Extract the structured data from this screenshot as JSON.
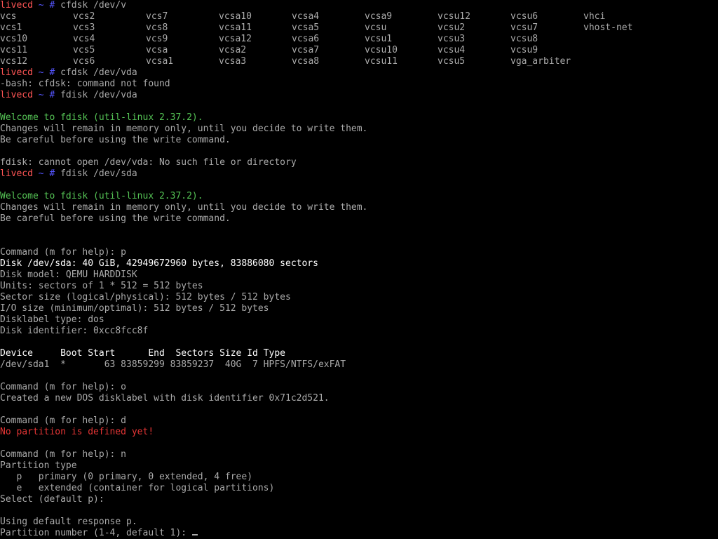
{
  "colors": {
    "background": "#000000",
    "default_text": "#aaaaaa",
    "bright_text": "#ffffff",
    "prompt_user": "#ff5555",
    "prompt_path": "#5555ff",
    "welcome_green": "#55c455",
    "error_red": "#e53535"
  },
  "prompt": {
    "user": "livecd",
    "path": "~",
    "symbol": "#"
  },
  "session": [
    {
      "kind": "prompt",
      "command": "cfdsk /dev/v"
    },
    {
      "kind": "ls_row",
      "cells": [
        "vcs",
        "vcs2",
        "vcs7",
        "vcsa10",
        "vcsa4",
        "vcsa9",
        "vcsu12",
        "vcsu6",
        "vhci"
      ]
    },
    {
      "kind": "ls_row",
      "cells": [
        "vcs1",
        "vcs3",
        "vcs8",
        "vcsa11",
        "vcsa5",
        "vcsu",
        "vcsu2",
        "vcsu7",
        "vhost-net"
      ]
    },
    {
      "kind": "ls_row",
      "cells": [
        "vcs10",
        "vcs4",
        "vcs9",
        "vcsa12",
        "vcsa6",
        "vcsu1",
        "vcsu3",
        "vcsu8",
        ""
      ]
    },
    {
      "kind": "ls_row",
      "cells": [
        "vcs11",
        "vcs5",
        "vcsa",
        "vcsa2",
        "vcsa7",
        "vcsu10",
        "vcsu4",
        "vcsu9",
        ""
      ]
    },
    {
      "kind": "ls_row",
      "cells": [
        "vcs12",
        "vcs6",
        "vcsa1",
        "vcsa3",
        "vcsa8",
        "vcsu11",
        "vcsu5",
        "vga_arbiter",
        ""
      ]
    },
    {
      "kind": "prompt",
      "command": "cfdsk /dev/vda"
    },
    {
      "kind": "text",
      "style": "default",
      "text": "-bash: cfdsk: command not found"
    },
    {
      "kind": "prompt",
      "command": "fdisk /dev/vda"
    },
    {
      "kind": "blank"
    },
    {
      "kind": "text",
      "style": "green",
      "text": "Welcome to fdisk (util-linux 2.37.2)."
    },
    {
      "kind": "text",
      "style": "default",
      "text": "Changes will remain in memory only, until you decide to write them."
    },
    {
      "kind": "text",
      "style": "default",
      "text": "Be careful before using the write command."
    },
    {
      "kind": "blank"
    },
    {
      "kind": "text",
      "style": "default",
      "text": "fdisk: cannot open /dev/vda: No such file or directory"
    },
    {
      "kind": "prompt",
      "command": "fdisk /dev/sda"
    },
    {
      "kind": "blank"
    },
    {
      "kind": "text",
      "style": "green",
      "text": "Welcome to fdisk (util-linux 2.37.2)."
    },
    {
      "kind": "text",
      "style": "default",
      "text": "Changes will remain in memory only, until you decide to write them."
    },
    {
      "kind": "text",
      "style": "default",
      "text": "Be careful before using the write command."
    },
    {
      "kind": "blank"
    },
    {
      "kind": "blank"
    },
    {
      "kind": "text",
      "style": "default",
      "text": "Command (m for help): p"
    },
    {
      "kind": "text",
      "style": "bright",
      "text": "Disk /dev/sda: 40 GiB, 42949672960 bytes, 83886080 sectors"
    },
    {
      "kind": "text",
      "style": "default",
      "text": "Disk model: QEMU HARDDISK"
    },
    {
      "kind": "text",
      "style": "default",
      "text": "Units: sectors of 1 * 512 = 512 bytes"
    },
    {
      "kind": "text",
      "style": "default",
      "text": "Sector size (logical/physical): 512 bytes / 512 bytes"
    },
    {
      "kind": "text",
      "style": "default",
      "text": "I/O size (minimum/optimal): 512 bytes / 512 bytes"
    },
    {
      "kind": "text",
      "style": "default",
      "text": "Disklabel type: dos"
    },
    {
      "kind": "text",
      "style": "default",
      "text": "Disk identifier: 0xcc8fcc8f"
    },
    {
      "kind": "blank"
    },
    {
      "kind": "text",
      "style": "bright",
      "text": "Device     Boot Start      End  Sectors Size Id Type"
    },
    {
      "kind": "text",
      "style": "default",
      "text": "/dev/sda1  *       63 83859299 83859237  40G  7 HPFS/NTFS/exFAT"
    },
    {
      "kind": "blank"
    },
    {
      "kind": "text",
      "style": "default",
      "text": "Command (m for help): o"
    },
    {
      "kind": "text",
      "style": "default",
      "text": "Created a new DOS disklabel with disk identifier 0x71c2d521."
    },
    {
      "kind": "blank"
    },
    {
      "kind": "text",
      "style": "default",
      "text": "Command (m for help): d"
    },
    {
      "kind": "text",
      "style": "red",
      "text": "No partition is defined yet!"
    },
    {
      "kind": "blank"
    },
    {
      "kind": "text",
      "style": "default",
      "text": "Command (m for help): n"
    },
    {
      "kind": "text",
      "style": "default",
      "text": "Partition type"
    },
    {
      "kind": "text",
      "style": "default",
      "text": "   p   primary (0 primary, 0 extended, 4 free)"
    },
    {
      "kind": "text",
      "style": "default",
      "text": "   e   extended (container for logical partitions)"
    },
    {
      "kind": "text",
      "style": "default",
      "text": "Select (default p): "
    },
    {
      "kind": "blank"
    },
    {
      "kind": "text",
      "style": "default",
      "text": "Using default response p."
    },
    {
      "kind": "input",
      "style": "default",
      "text": "Partition number (1-4, default 1): "
    }
  ]
}
